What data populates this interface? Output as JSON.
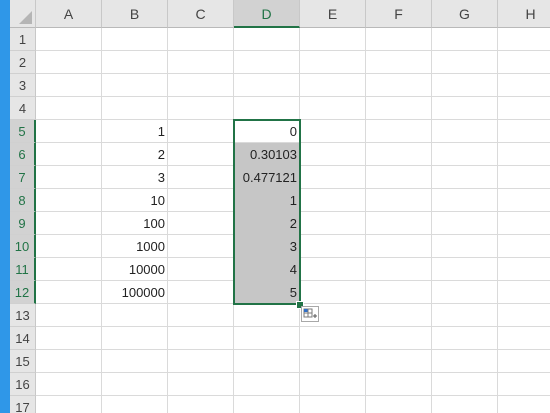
{
  "columns": [
    "A",
    "B",
    "C",
    "D",
    "E",
    "F",
    "G",
    "H"
  ],
  "rows": [
    "1",
    "2",
    "3",
    "4",
    "5",
    "6",
    "7",
    "8",
    "9",
    "10",
    "11",
    "12",
    "13",
    "14",
    "15",
    "16",
    "17"
  ],
  "selected_column": "D",
  "selected_range": "D5:D12",
  "column_b_values": [
    "1",
    "2",
    "3",
    "10",
    "100",
    "1000",
    "10000",
    "100000"
  ],
  "column_d_values": [
    "0",
    "0.30103",
    "0.477121",
    "1",
    "2",
    "3",
    "4",
    "5"
  ],
  "colors": {
    "selection_border": "#217346",
    "selection_fill": "#c6c6c6",
    "header_bg": "#e6e6e6",
    "accent_strip": "#2f97e8"
  },
  "icons": {
    "corner": "select-all-triangle-icon",
    "quick_analysis": "quick-analysis-icon"
  }
}
